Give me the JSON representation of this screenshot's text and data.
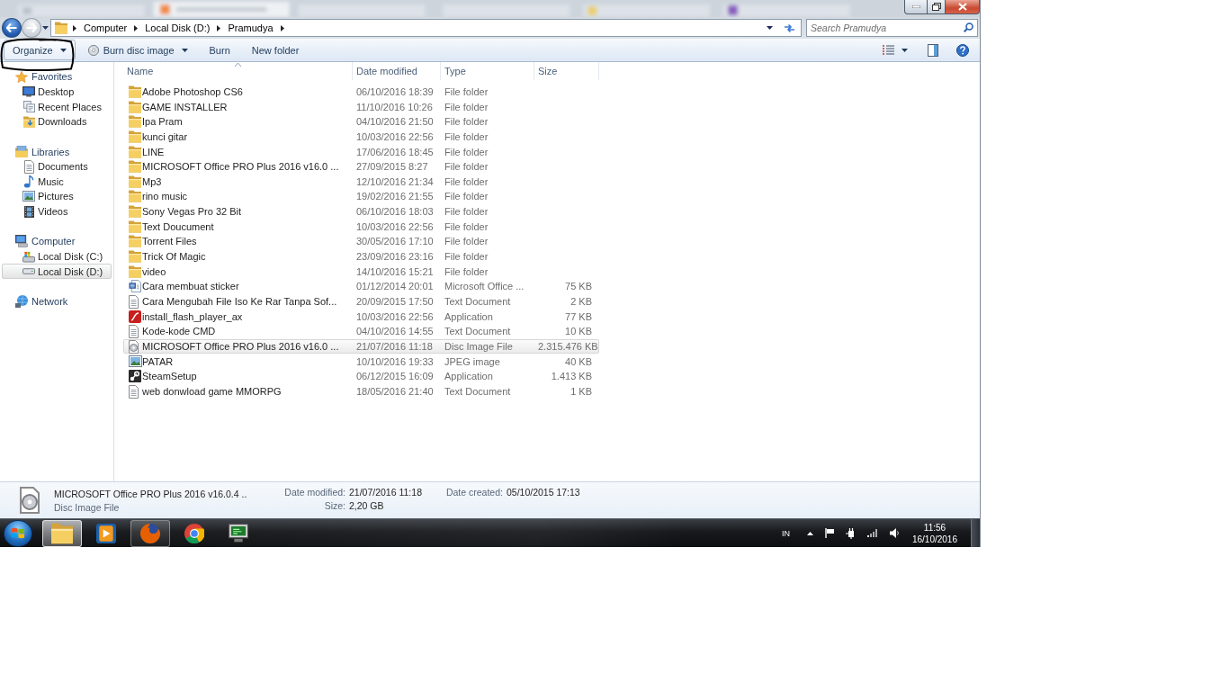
{
  "navigation_buttons": {
    "back_enabled": true,
    "forward_enabled": false
  },
  "address_bar": {
    "breadcrumb": [
      "Computer",
      "Local Disk (D:)",
      "Pramudya"
    ]
  },
  "search": {
    "placeholder": "Search Pramudya"
  },
  "toolbar": [
    {
      "label": "Organize",
      "kind": "plain",
      "dropdown": true,
      "focused": true
    },
    {
      "label": "Burn disc image",
      "kind": "disc",
      "dropdown": true,
      "focused": false
    },
    {
      "label": "Burn",
      "kind": "plain",
      "dropdown": false,
      "focused": false
    },
    {
      "label": "New folder",
      "kind": "plain",
      "dropdown": false,
      "focused": false
    }
  ],
  "navigation": [
    {
      "label": "Favorites",
      "kind": "star",
      "selected": false,
      "children": [
        {
          "label": "Desktop",
          "kind": "desktop",
          "selected": false
        },
        {
          "label": "Recent Places",
          "kind": "recent",
          "selected": false
        },
        {
          "label": "Downloads",
          "kind": "downloads",
          "selected": false
        }
      ]
    },
    {
      "label": "Libraries",
      "kind": "library",
      "selected": false,
      "children": [
        {
          "label": "Documents",
          "kind": "documents",
          "selected": false
        },
        {
          "label": "Music",
          "kind": "music",
          "selected": false
        },
        {
          "label": "Pictures",
          "kind": "pictures",
          "selected": false
        },
        {
          "label": "Videos",
          "kind": "videos",
          "selected": false
        }
      ]
    },
    {
      "label": "Computer",
      "kind": "computer",
      "selected": false,
      "children": [
        {
          "label": "Local Disk (C:)",
          "kind": "systemdrive",
          "selected": false
        },
        {
          "label": "Local Disk (D:)",
          "kind": "drive",
          "selected": true
        }
      ]
    },
    {
      "label": "Network",
      "kind": "network",
      "selected": false
    }
  ],
  "columns": [
    {
      "label": "Name",
      "sorted": true
    },
    {
      "label": "Date modified",
      "sorted": false
    },
    {
      "label": "Type",
      "sorted": false
    },
    {
      "label": "Size",
      "sorted": false
    }
  ],
  "files": [
    {
      "name": "Adobe Photoshop CS6",
      "date_modified": "06/10/2016 18:39",
      "type": "File folder",
      "kind": "folder",
      "selected": false
    },
    {
      "name": "GAME INSTALLER",
      "date_modified": "11/10/2016 10:26",
      "type": "File folder",
      "kind": "folder",
      "selected": false
    },
    {
      "name": "Ipa Pram",
      "date_modified": "04/10/2016 21:50",
      "type": "File folder",
      "kind": "folder",
      "selected": false
    },
    {
      "name": "kunci gitar",
      "date_modified": "10/03/2016 22:56",
      "type": "File folder",
      "kind": "folder",
      "selected": false
    },
    {
      "name": "LINE",
      "date_modified": "17/06/2016 18:45",
      "type": "File folder",
      "kind": "folder",
      "selected": false
    },
    {
      "name": "MICROSOFT Office PRO Plus 2016 v16.0 ...",
      "date_modified": "27/09/2015 8:27",
      "type": "File folder",
      "kind": "folder",
      "selected": false
    },
    {
      "name": "Mp3",
      "date_modified": "12/10/2016 21:34",
      "type": "File folder",
      "kind": "folder",
      "selected": false
    },
    {
      "name": "rino music",
      "date_modified": "19/02/2016 21:55",
      "type": "File folder",
      "kind": "folder",
      "selected": false
    },
    {
      "name": "Sony Vegas Pro 32 Bit",
      "date_modified": "06/10/2016 18:03",
      "type": "File folder",
      "kind": "folder",
      "selected": false
    },
    {
      "name": "Text Doucument",
      "date_modified": "10/03/2016 22:56",
      "type": "File folder",
      "kind": "folder",
      "selected": false
    },
    {
      "name": "Torrent Files",
      "date_modified": "30/05/2016 17:10",
      "type": "File folder",
      "kind": "folder",
      "selected": false
    },
    {
      "name": "Trick Of Magic",
      "date_modified": "23/09/2016 23:16",
      "type": "File folder",
      "kind": "folder",
      "selected": false
    },
    {
      "name": "video",
      "date_modified": "14/10/2016 15:21",
      "type": "File folder",
      "kind": "folder",
      "selected": false
    },
    {
      "name": "Cara membuat sticker",
      "date_modified": "01/12/2014 20:01",
      "type": "Microsoft Office ...",
      "size": "75 KB",
      "kind": "document",
      "selected": false
    },
    {
      "name": "Cara Mengubah File Iso Ke Rar Tanpa Sof...",
      "date_modified": "20/09/2015 17:50",
      "type": "Text Document",
      "size": "2 KB",
      "kind": "text",
      "selected": false
    },
    {
      "name": "install_flash_player_ax",
      "date_modified": "10/03/2016 22:56",
      "type": "Application",
      "size": "77 KB",
      "kind": "installer",
      "selected": false
    },
    {
      "name": "Kode-kode CMD",
      "date_modified": "04/10/2016 14:55",
      "type": "Text Document",
      "size": "10 KB",
      "kind": "text",
      "selected": false
    },
    {
      "name": "MICROSOFT Office PRO Plus 2016 v16.0 ...",
      "date_modified": "21/07/2016 11:18",
      "type": "Disc Image File",
      "size": "2.315.476 KB",
      "kind": "disc",
      "selected": true
    },
    {
      "name": "PATAR",
      "date_modified": "10/10/2016 19:33",
      "type": "JPEG image",
      "size": "40 KB",
      "kind": "image",
      "selected": false
    },
    {
      "name": "SteamSetup",
      "date_modified": "06/12/2015 16:09",
      "type": "Application",
      "size": "1.413 KB",
      "kind": "program",
      "selected": false
    },
    {
      "name": "web donwload game MMORPG",
      "date_modified": "18/05/2016 21:40",
      "type": "Text Document",
      "size": "1 KB",
      "kind": "text",
      "selected": false
    }
  ],
  "details": {
    "name": "MICROSOFT Office PRO Plus 2016 v16.0.4 ..",
    "kind": "disc",
    "type": "Disc Image File",
    "fields": [
      {
        "label": "Date modified:",
        "value": "21/07/2016 11:18"
      },
      {
        "label": "Size:",
        "value": "2,20 GB"
      },
      {
        "label": "Date created:",
        "value": "05/10/2015 17:13"
      }
    ]
  },
  "taskbar": {
    "apps": [
      {
        "kind": "folder",
        "selected": true,
        "running": true
      },
      {
        "kind": "player",
        "selected": false,
        "running": false
      },
      {
        "kind": "globe",
        "selected": false,
        "running": true
      },
      {
        "kind": "wheel",
        "selected": false,
        "running": false
      },
      {
        "kind": "terminal",
        "selected": false,
        "running": false
      }
    ],
    "tray": {
      "language": "IN",
      "time": "11:56",
      "date": "16/10/2016"
    }
  }
}
